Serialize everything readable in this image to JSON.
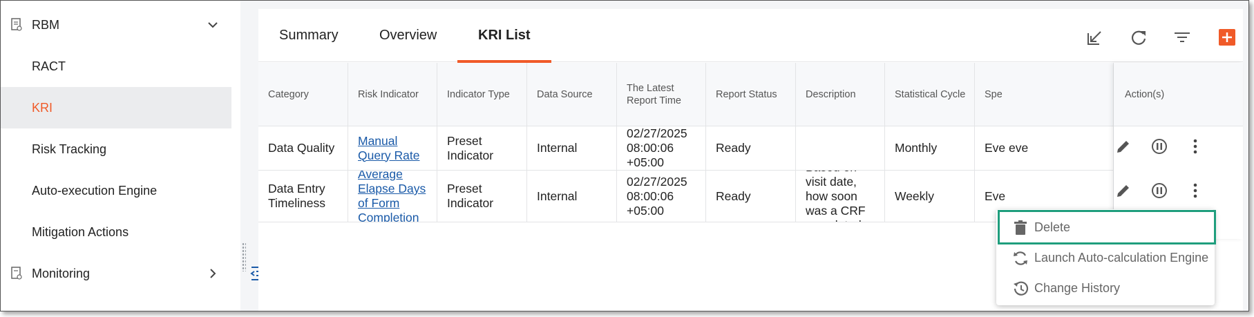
{
  "sidebar": {
    "items": [
      {
        "label": "RBM"
      },
      {
        "label": "RACT"
      },
      {
        "label": "KRI"
      },
      {
        "label": "Risk Tracking"
      },
      {
        "label": "Auto-execution Engine"
      },
      {
        "label": "Mitigation Actions"
      },
      {
        "label": "Monitoring"
      }
    ]
  },
  "tabs": [
    {
      "label": "Summary"
    },
    {
      "label": "Overview"
    },
    {
      "label": "KRI List"
    }
  ],
  "toolbar": {
    "icons": [
      "export-icon",
      "refresh-icon",
      "filter-icon",
      "add-icon"
    ],
    "accent": "#f05a28"
  },
  "table": {
    "headers": [
      "Category",
      "Risk Indicator",
      "Indicator Type",
      "Data Source",
      "The Latest Report Time",
      "Report Status",
      "Description",
      "Statistical Cycle",
      "Spe",
      "Action(s)"
    ],
    "rows": [
      {
        "category": "Data Quality",
        "risk_indicator": "Manual Query Rate",
        "indicator_type": "Preset Indicator",
        "data_source": "Internal",
        "latest_report_time": "02/27/2025 08:00:06 +05:00",
        "report_status": "Ready",
        "description": "",
        "statistical_cycle": "Monthly",
        "spec": "Eve eve"
      },
      {
        "category": "Data Entry Timeliness",
        "risk_indicator": "Average Elapse Days of Form Completion",
        "indicator_type": "Preset Indicator",
        "data_source": "Internal",
        "latest_report_time": "02/27/2025 08:00:06 +05:00",
        "report_status": "Ready",
        "description": "Based on visit date, how soon was a CRF completed",
        "statistical_cycle": "Weekly",
        "spec": "Eve"
      }
    ]
  },
  "menu": {
    "items": [
      {
        "label": "Delete",
        "icon": "trash-icon"
      },
      {
        "label": "Launch Auto-calculation Engine",
        "icon": "sync-icon"
      },
      {
        "label": "Change History",
        "icon": "history-icon"
      }
    ]
  },
  "colors": {
    "link": "#1a5aa8",
    "highlight": "#1f9e7d"
  }
}
